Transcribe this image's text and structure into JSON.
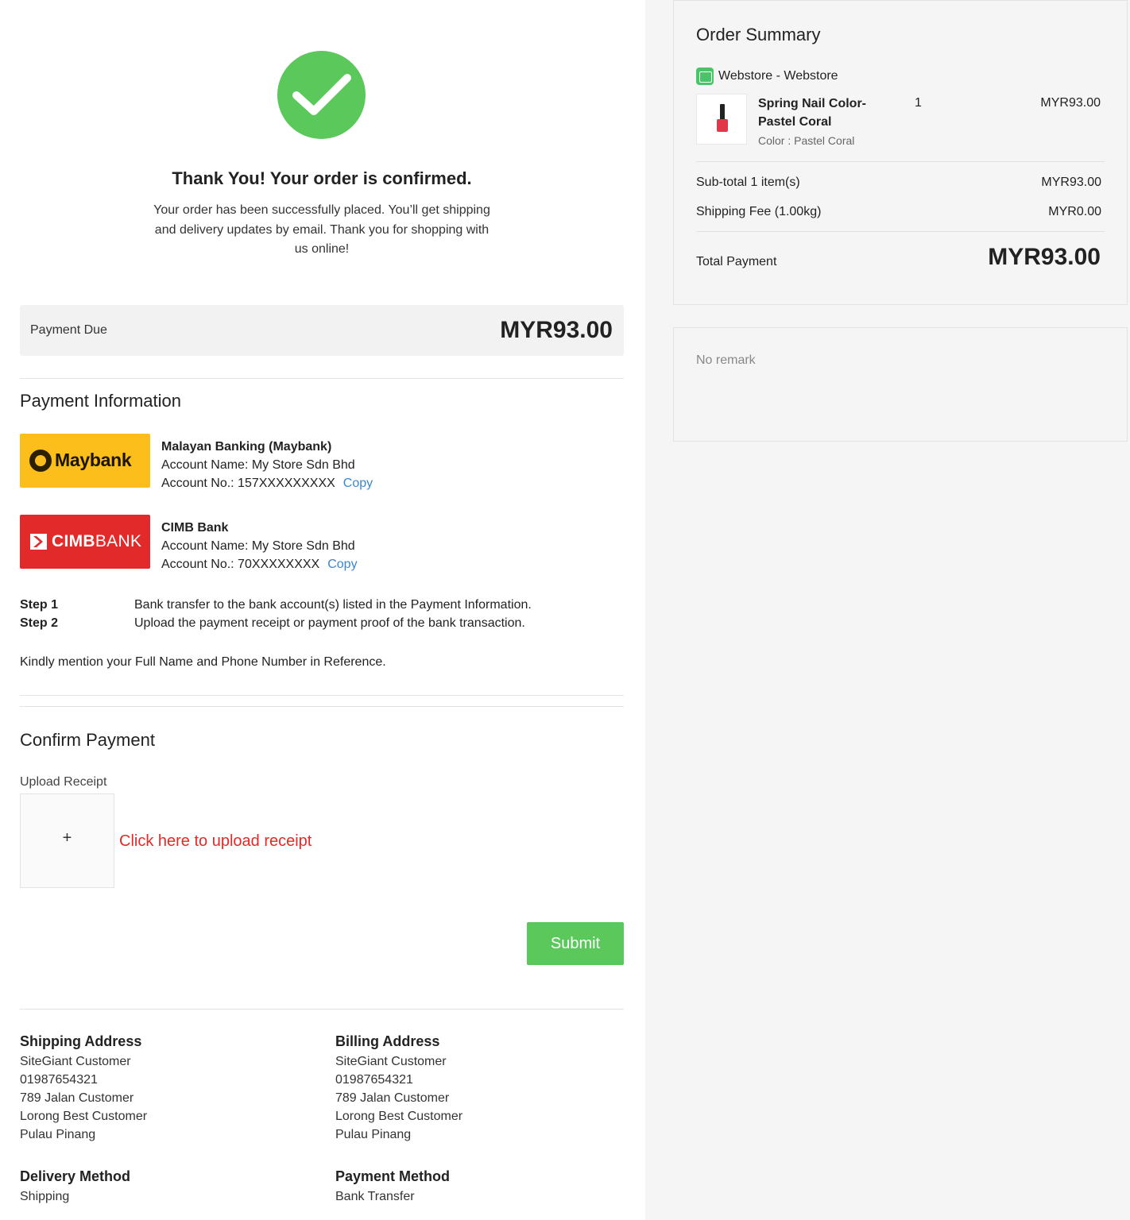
{
  "confirmation": {
    "title": "Thank You! Your order is confirmed.",
    "message": "Your order has been successfully placed. You’ll get shipping and delivery updates by email. Thank you for shopping with us online!"
  },
  "payment_due": {
    "label": "Payment Due",
    "amount": "MYR93.00"
  },
  "payment_info": {
    "title": "Payment Information",
    "banks": [
      {
        "logo_text": "Maybank",
        "name": "Malayan Banking (Maybank)",
        "account_name": "Account Name: My Store Sdn Bhd",
        "account_no": "Account No.: 157XXXXXXXXX",
        "copy_label": "Copy"
      },
      {
        "logo_text_bold": "CIMB",
        "logo_text_light": "BANK",
        "name": "CIMB Bank",
        "account_name": "Account Name: My Store Sdn Bhd",
        "account_no": "Account No.: 70XXXXXXXX",
        "copy_label": "Copy"
      }
    ],
    "steps": [
      {
        "label": "Step 1",
        "text": "Bank transfer to the bank account(s) listed in the Payment Information."
      },
      {
        "label": "Step 2",
        "text": "Upload the payment receipt or payment proof of the bank transaction."
      }
    ],
    "note": "Kindly mention your Full Name and Phone Number in Reference."
  },
  "confirm_payment": {
    "title": "Confirm Payment",
    "upload_label": "Upload Receipt",
    "upload_plus": "+",
    "upload_link": "Click here to upload receipt",
    "submit_label": "Submit"
  },
  "shipping_address": {
    "heading": "Shipping Address",
    "lines": [
      "SiteGiant Customer",
      "01987654321",
      "789 Jalan Customer",
      "Lorong Best Customer",
      "Pulau Pinang"
    ]
  },
  "billing_address": {
    "heading": "Billing Address",
    "lines": [
      "SiteGiant Customer",
      "01987654321",
      "789 Jalan Customer",
      "Lorong Best Customer",
      "Pulau Pinang"
    ]
  },
  "delivery_method": {
    "heading": "Delivery Method",
    "value": "Shipping"
  },
  "payment_method": {
    "heading": "Payment Method",
    "value": "Bank Transfer"
  },
  "order_summary": {
    "title": "Order Summary",
    "store": "Webstore - Webstore",
    "item": {
      "name": "Spring Nail Color-Pastel Coral",
      "variant": "Color : Pastel Coral",
      "qty": "1",
      "price": "MYR93.00"
    },
    "subtotal_label": "Sub-total 1 item(s)",
    "subtotal_value": "MYR93.00",
    "shipping_label": "Shipping Fee (1.00kg)",
    "shipping_value": "MYR0.00",
    "total_label": "Total Payment",
    "total_value": "MYR93.00"
  },
  "remark": {
    "text": "No remark"
  },
  "colors": {
    "accent_green": "#5ac85a",
    "link_blue": "#3a86d6",
    "upload_red": "#e62828",
    "maybank_yellow": "#fbbe1a",
    "cimb_red": "#e22a2a"
  }
}
